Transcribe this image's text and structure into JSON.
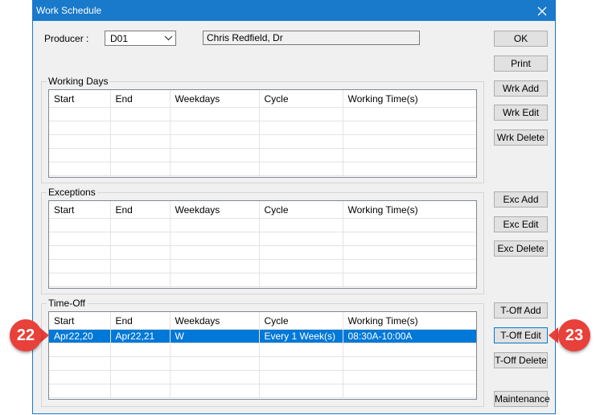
{
  "window": {
    "title": "Work Schedule"
  },
  "producer": {
    "label": "Producer :",
    "value": "D01",
    "name": "Chris Redfield, Dr"
  },
  "columns": [
    "Start",
    "End",
    "Weekdays",
    "Cycle",
    "Working Time(s)"
  ],
  "working_days": {
    "label": "Working Days"
  },
  "exceptions": {
    "label": "Exceptions"
  },
  "time_off": {
    "label": "Time-Off",
    "rows": [
      {
        "start": "Apr22,20",
        "end": "Apr22,21",
        "weekdays": "W",
        "cycle": "Every 1 Week(s)",
        "time": "08:30A-10:00A"
      }
    ]
  },
  "buttons": {
    "ok": "OK",
    "print": "Print",
    "wrk_add": "Wrk Add",
    "wrk_edit": "Wrk Edit",
    "wrk_delete": "Wrk Delete",
    "exc_add": "Exc Add",
    "exc_edit": "Exc Edit",
    "exc_delete": "Exc Delete",
    "toff_add": "T-Off Add",
    "toff_edit": "T-Off Edit",
    "toff_delete": "T-Off Delete",
    "maintenance": "Maintenance"
  },
  "callouts": {
    "left": "22",
    "right": "23"
  },
  "colors": {
    "titlebar": "#1979ca",
    "selection": "#0078d7",
    "callout": "#e8403a"
  }
}
